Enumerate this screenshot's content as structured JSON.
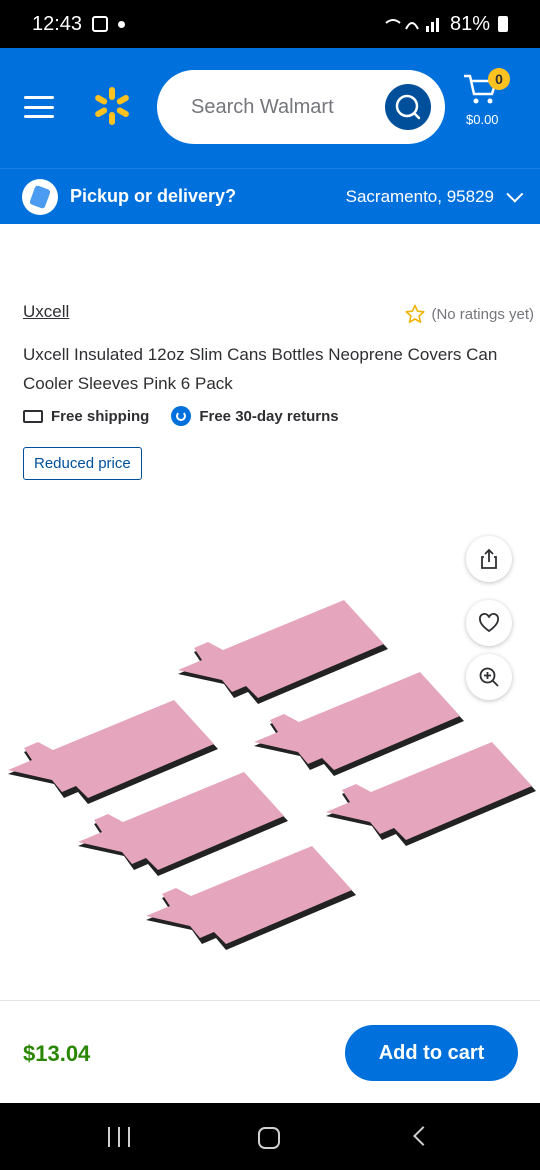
{
  "status_bar": {
    "time": "12:43",
    "battery": "81%"
  },
  "header": {
    "search": {
      "placeholder": "Search Walmart"
    },
    "cart": {
      "count": "0",
      "total": "$0.00"
    }
  },
  "pickup": {
    "label": "Pickup or delivery?",
    "location": "Sacramento, 95829"
  },
  "product": {
    "brand": "Uxcell",
    "rating_text": "(No ratings yet)",
    "title": "Uxcell Insulated 12oz Slim Cans Bottles Neoprene Covers Can Cooler Sleeves Pink 6 Pack",
    "shipping": "Free shipping",
    "returns": "Free 30-day returns",
    "badge": "Reduced price",
    "sleeve_color": "#e5a6bd"
  },
  "bottom": {
    "price": "$13.04",
    "add_to_cart": "Add to cart"
  },
  "colors": {
    "brand_blue": "#0071dc",
    "spark_yellow": "#ffc220",
    "price_green": "#2a8703"
  },
  "icons": [
    "menu-icon",
    "spark-logo-icon",
    "search-icon",
    "cart-icon",
    "share-icon",
    "heart-icon",
    "zoom-icon",
    "star-icon",
    "truck-icon",
    "return-icon"
  ]
}
